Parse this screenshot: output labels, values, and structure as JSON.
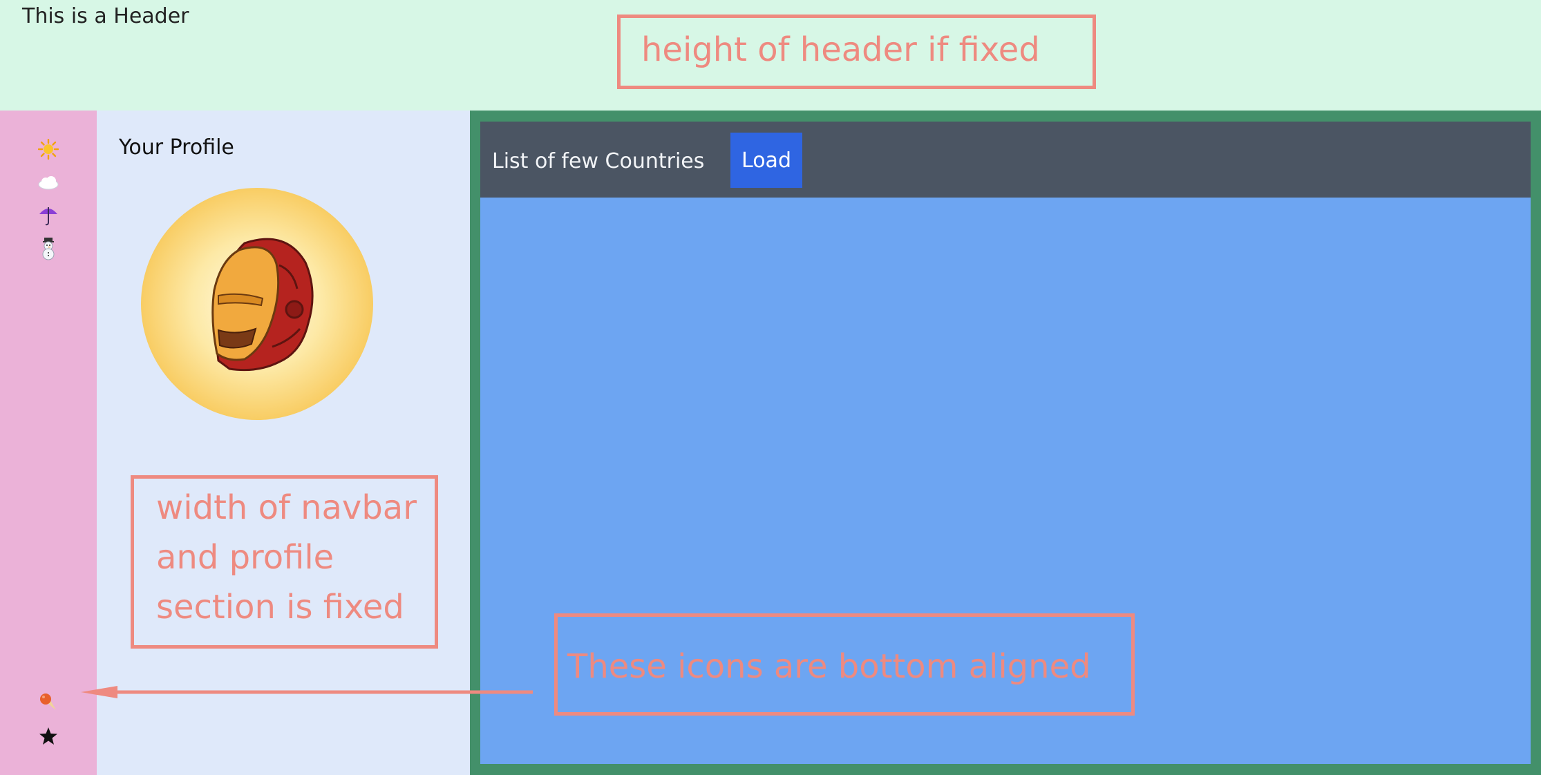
{
  "header": {
    "title": "This is a Header"
  },
  "navbar": {
    "top_icons": [
      "sun-icon",
      "cloud-icon",
      "umbrella-icon",
      "snowman-icon"
    ],
    "bottom_icons": [
      "ice-cream-icon",
      "star-icon"
    ]
  },
  "profile": {
    "title": "Your Profile",
    "avatar": "iron-man-helmet-icon"
  },
  "content": {
    "toolbar_title": "List of few Countries",
    "load_label": "Load"
  },
  "annotations": {
    "header_height": "height of header if fixed",
    "width_fixed": [
      "width of navbar",
      "and profile",
      "section is fixed"
    ],
    "icons_bottom": "These icons are bottom aligned"
  },
  "colors": {
    "header_bg": "#d7f7e6",
    "navbar_bg": "#ebb2d8",
    "profile_bg": "#dfe9fa",
    "frame_border": "#43906a",
    "toolbar_bg": "#4b5563",
    "load_button_bg": "#2f65e2",
    "list_bg": "#6da5f2",
    "annotation": "#ee8a80"
  }
}
